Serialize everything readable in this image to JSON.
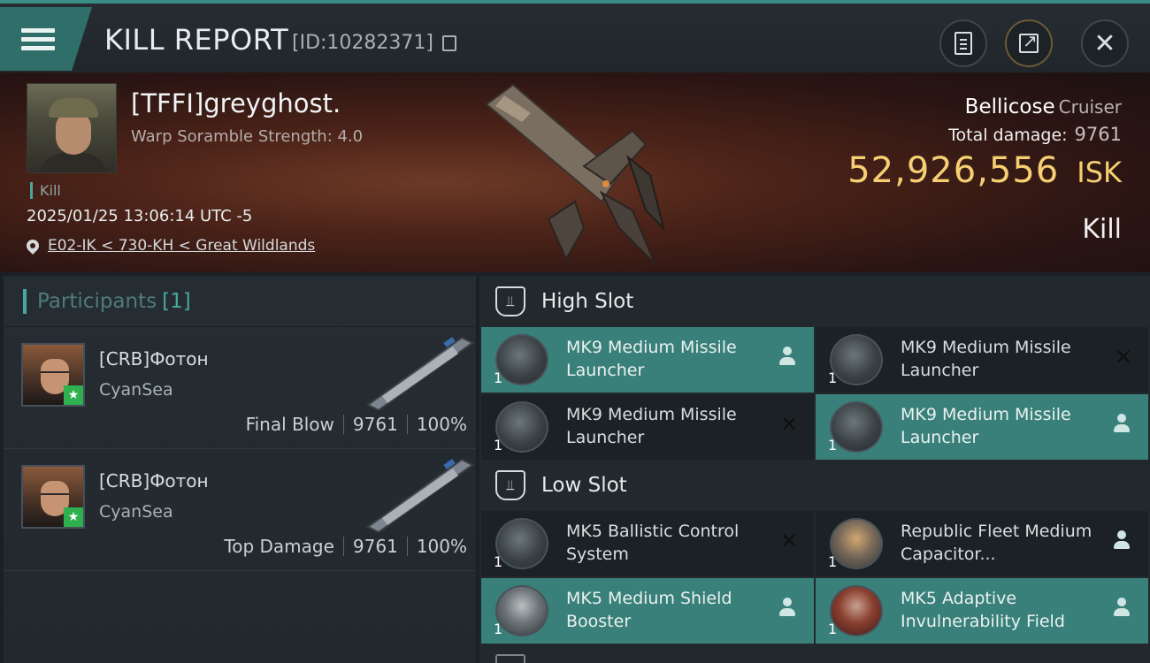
{
  "header": {
    "title": "KILL REPORT",
    "report_id": "[ID:10282371]"
  },
  "victim": {
    "name": "[TFFI]greyghost.",
    "scramble": "Warp Soramble Strength: 4.0",
    "tag": "Kill",
    "datetime": "2025/01/25 13:06:14 UTC -5",
    "location": "E02-IK < 730-KH < Great Wildlands"
  },
  "ship": {
    "name": "Bellicose",
    "class": "Cruiser",
    "total_damage_label": "Total damage:",
    "total_damage": "9761",
    "isk_value": "52,926,556",
    "isk_unit": "ISK",
    "result": "Kill"
  },
  "participants": {
    "title": "Participants",
    "count": "[1]",
    "rows": [
      {
        "name": "[CRB]Фотон",
        "corp": "CyanSea",
        "role": "Final Blow",
        "damage": "9761",
        "percent": "100%"
      },
      {
        "name": "[CRB]Фотон",
        "corp": "CyanSea",
        "role": "Top Damage",
        "damage": "9761",
        "percent": "100%"
      }
    ]
  },
  "slots": {
    "high": {
      "title": "High Slot",
      "modules": [
        {
          "name": "MK9 Medium Missile Launcher",
          "qty": "1",
          "status": "fitted",
          "icon": "missile-launcher-icon"
        },
        {
          "name": "MK9 Medium Missile Launcher",
          "qty": "1",
          "status": "destroyed",
          "icon": "missile-launcher-icon"
        },
        {
          "name": "MK9 Medium Missile Launcher",
          "qty": "1",
          "status": "destroyed",
          "icon": "missile-launcher-icon"
        },
        {
          "name": "MK9 Medium Missile Launcher",
          "qty": "1",
          "status": "fitted",
          "icon": "missile-launcher-icon"
        }
      ]
    },
    "low": {
      "title": "Low Slot",
      "modules": [
        {
          "name": "MK5 Ballistic Control System",
          "qty": "1",
          "status": "destroyed",
          "icon": "ballistic-control-icon"
        },
        {
          "name": "Republic Fleet Medium Capacitor...",
          "qty": "1",
          "status": "fitted",
          "icon": "capacitor-booster-icon"
        },
        {
          "name": "MK5 Medium Shield Booster",
          "qty": "1",
          "status": "fitted",
          "icon": "shield-booster-icon"
        },
        {
          "name": "MK5 Adaptive Invulnerability Field",
          "qty": "1",
          "status": "fitted",
          "icon": "invulnerability-field-icon"
        }
      ]
    }
  },
  "colors": {
    "accent": "#3a807a",
    "isk": "#f5cf72",
    "destroyed_bg": "#1c2125"
  }
}
